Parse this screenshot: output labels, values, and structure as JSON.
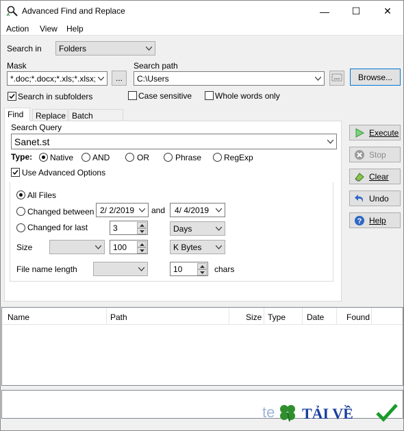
{
  "window": {
    "title": "Advanced Find and Replace",
    "controls": {
      "minimize": "—",
      "maximize": "☐",
      "close": "✕"
    }
  },
  "menu": [
    "Action",
    "View",
    "Help"
  ],
  "search_in": {
    "label": "Search in",
    "value": "Folders"
  },
  "mask": {
    "label": "Mask",
    "value": "*.doc;*.docx;*.xls;*.xlsx;*.h",
    "browse_label": "..."
  },
  "search_path": {
    "label": "Search path",
    "value": "C:\\Users",
    "browse_label": "Browse..."
  },
  "options": {
    "subfolders": "Search in subfolders",
    "case_sensitive": "Case sensitive",
    "whole_words": "Whole words only"
  },
  "tabs": [
    "Find",
    "Replace",
    "Batch Replace"
  ],
  "query": {
    "label": "Search Query",
    "value": "Sanet.st"
  },
  "type": {
    "label": "Type:",
    "options": [
      "Native",
      "AND",
      "OR",
      "Phrase",
      "RegExp"
    ],
    "selected": "Native"
  },
  "advanced": {
    "label": "Use Advanced Options",
    "all_files": "All Files",
    "changed_between": "Changed between",
    "date_from": "2/  2/2019",
    "and_label": "and",
    "date_to": "4/  4/2019",
    "changed_for_last": "Changed for last",
    "last_value": "3",
    "last_unit": "Days",
    "size_label": "Size",
    "size_op": "",
    "size_value": "100",
    "size_unit": "K Bytes",
    "fname_label": "File name length",
    "fname_op": "",
    "fname_value": "10",
    "fname_unit": "chars"
  },
  "side_buttons": {
    "execute": "Execute",
    "stop": "Stop",
    "clear": "Clear",
    "undo": "Undo",
    "help": "Help"
  },
  "results_columns": [
    "Name",
    "Path",
    "Size",
    "Type",
    "Date",
    "Found"
  ],
  "watermark": {
    "text": "TẢI VỀ"
  },
  "colors": {
    "accent": "#0078d7",
    "watermark_text": "#1a3e9e",
    "check_green": "#1a9a2a",
    "clover": "#2f8f2f"
  }
}
